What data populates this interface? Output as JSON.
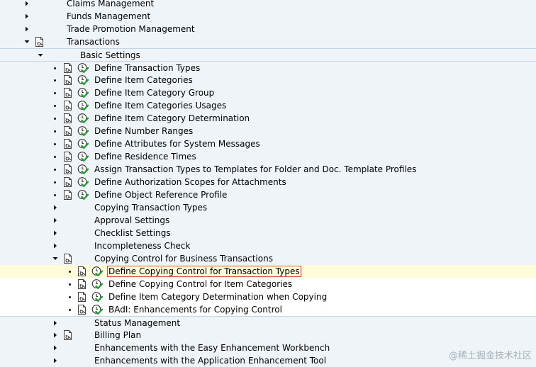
{
  "tree": {
    "rows": [
      {
        "label": "Claims Management",
        "level": 0,
        "toggle": "collapsed",
        "doc": false,
        "exec": false,
        "band": "blue"
      },
      {
        "label": "Funds Management",
        "level": 0,
        "toggle": "collapsed",
        "doc": false,
        "exec": false,
        "band": "blue"
      },
      {
        "label": "Trade Promotion Management",
        "level": 0,
        "toggle": "collapsed",
        "doc": false,
        "exec": false,
        "band": "blue"
      },
      {
        "label": "Transactions",
        "level": 0,
        "toggle": "expanded",
        "doc": true,
        "exec": false,
        "band": "blue"
      },
      {
        "label": "Basic Settings",
        "level": 1,
        "toggle": "expanded",
        "doc": false,
        "exec": false,
        "band": "blue",
        "sepTop": true
      },
      {
        "label": "Define Transaction Types",
        "level": 2,
        "toggle": "leaf",
        "doc": true,
        "exec": true,
        "band": "blue",
        "sepTop": true
      },
      {
        "label": "Define Item Categories",
        "level": 2,
        "toggle": "leaf",
        "doc": true,
        "exec": true,
        "band": "blue"
      },
      {
        "label": "Define Item Category Group",
        "level": 2,
        "toggle": "leaf",
        "doc": true,
        "exec": true,
        "band": "blue"
      },
      {
        "label": "Define Item Categories Usages",
        "level": 2,
        "toggle": "leaf",
        "doc": true,
        "exec": true,
        "band": "blue"
      },
      {
        "label": "Define Item Category Determination",
        "level": 2,
        "toggle": "leaf",
        "doc": true,
        "exec": true,
        "band": "blue"
      },
      {
        "label": "Define Number Ranges",
        "level": 2,
        "toggle": "leaf",
        "doc": true,
        "exec": true,
        "band": "blue"
      },
      {
        "label": "Define Attributes for System Messages",
        "level": 2,
        "toggle": "leaf",
        "doc": true,
        "exec": true,
        "band": "blue"
      },
      {
        "label": "Define Residence Times",
        "level": 2,
        "toggle": "leaf",
        "doc": true,
        "exec": true,
        "band": "blue"
      },
      {
        "label": "Assign Transaction Types to Templates for Folder and Doc. Template Profiles",
        "level": 2,
        "toggle": "leaf",
        "doc": true,
        "exec": true,
        "band": "blue"
      },
      {
        "label": "Define Authorization Scopes for Attachments",
        "level": 2,
        "toggle": "leaf",
        "doc": true,
        "exec": true,
        "band": "blue"
      },
      {
        "label": "Define Object Reference Profile",
        "level": 2,
        "toggle": "leaf",
        "doc": true,
        "exec": true,
        "band": "blue"
      },
      {
        "label": "Copying Transaction Types",
        "level": 2,
        "toggle": "collapsed",
        "doc": false,
        "exec": false,
        "band": "blue"
      },
      {
        "label": "Approval Settings",
        "level": 2,
        "toggle": "collapsed",
        "doc": false,
        "exec": false,
        "band": "blue"
      },
      {
        "label": "Checklist Settings",
        "level": 2,
        "toggle": "collapsed",
        "doc": false,
        "exec": false,
        "band": "blue"
      },
      {
        "label": "Incompleteness Check",
        "level": 2,
        "toggle": "collapsed",
        "doc": false,
        "exec": false,
        "band": "blue"
      },
      {
        "label": "Copying Control for Business Transactions",
        "level": 2,
        "toggle": "expanded",
        "doc": true,
        "exec": false,
        "band": "blue"
      },
      {
        "label": "Define Copying Control for Transaction Types",
        "level": 3,
        "toggle": "leaf",
        "doc": true,
        "exec": true,
        "band": "selected",
        "focus": true,
        "sepTop": true
      },
      {
        "label": "Define Copying Control for Item Categories",
        "level": 3,
        "toggle": "leaf",
        "doc": true,
        "exec": true,
        "band": "white"
      },
      {
        "label": "Define Item Category Determination when Copying",
        "level": 3,
        "toggle": "leaf",
        "doc": true,
        "exec": true,
        "band": "white"
      },
      {
        "label": "BAdI: Enhancements for Copying Control",
        "level": 3,
        "toggle": "leaf",
        "doc": true,
        "exec": true,
        "band": "white"
      },
      {
        "label": "Status Management",
        "level": 2,
        "toggle": "collapsed",
        "doc": false,
        "exec": false,
        "band": "blue",
        "sepTop": true
      },
      {
        "label": "Billing Plan",
        "level": 2,
        "toggle": "collapsed",
        "doc": true,
        "exec": false,
        "band": "blue"
      },
      {
        "label": "Enhancements with the Easy Enhancement Workbench",
        "level": 2,
        "toggle": "collapsed",
        "doc": false,
        "exec": false,
        "band": "blue"
      },
      {
        "label": "Enhancements with the Application Enhancement Tool",
        "level": 2,
        "toggle": "collapsed",
        "doc": false,
        "exec": false,
        "band": "blue"
      }
    ]
  },
  "icons": {
    "collapsed": "triangle-right-icon",
    "expanded": "triangle-down-icon",
    "leaf": "bullet-icon",
    "doc": "documentation-icon",
    "exec": "execute-clock-check-icon"
  },
  "colors": {
    "band_blue": "#eef4f8",
    "selected": "#fefcd9",
    "focus_border": "#e04a3a",
    "check_green": "#2e9b3a"
  },
  "watermark": "@稀土掘金技术社区"
}
